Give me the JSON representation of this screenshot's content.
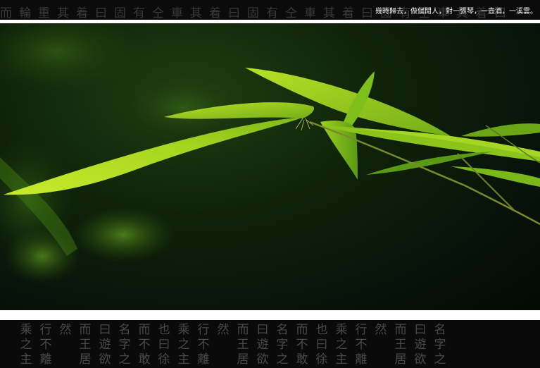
{
  "header": {
    "decorative_glyphs": "而輪重其着曰固有仝車其着曰固有仝車其着曰固有仝車其着曰",
    "tagline": "幾時歸去，做個閒人，對一張琴，一壺酒，一溪雲。"
  },
  "photo": {
    "subject": "bamboo leaves",
    "colors": {
      "leaf_bright": "#c8e82a",
      "leaf_mid": "#8cc41c",
      "leaf_dark": "#4f8a12",
      "background_dark": "#07120a"
    }
  },
  "footer": {
    "columns": [
      [
        "乘",
        "之",
        "主"
      ],
      [
        "行",
        "不",
        "離"
      ],
      [
        "然",
        "",
        ""
      ],
      [
        "而",
        "王",
        "居"
      ],
      [
        "曰",
        "遊",
        "欲"
      ],
      [
        "名",
        "字",
        "之"
      ],
      [
        "而",
        "不",
        "敢"
      ],
      [
        "也",
        "曰",
        "徐"
      ],
      [
        "乘",
        "之",
        "主"
      ],
      [
        "行",
        "不",
        "離"
      ],
      [
        "然",
        "",
        ""
      ],
      [
        "而",
        "王",
        "居"
      ],
      [
        "曰",
        "遊",
        "欲"
      ],
      [
        "名",
        "字",
        "之"
      ],
      [
        "而",
        "不",
        "敢"
      ],
      [
        "也",
        "曰",
        "徐"
      ],
      [
        "乘",
        "之",
        "主"
      ],
      [
        "行",
        "不",
        "離"
      ],
      [
        "然",
        "",
        ""
      ],
      [
        "而",
        "王",
        "居"
      ],
      [
        "曰",
        "遊",
        "欲"
      ],
      [
        "名",
        "字",
        "之"
      ]
    ]
  }
}
